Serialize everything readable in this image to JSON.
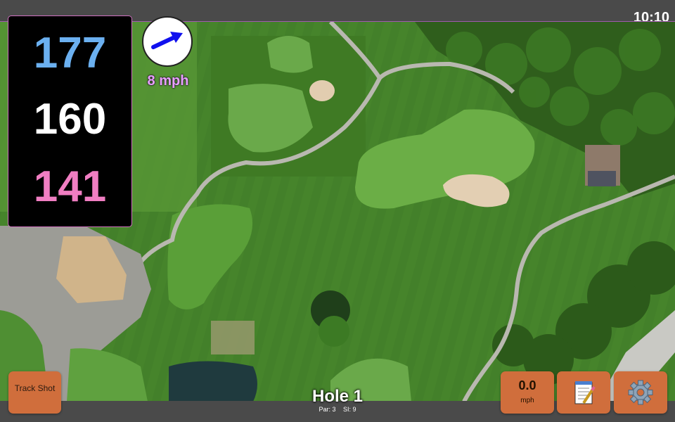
{
  "status": {
    "time": "10:10"
  },
  "yardage": {
    "back": "177",
    "middle": "160",
    "front": "141"
  },
  "wind": {
    "speed": "8 mph",
    "icon": "arrow-icon"
  },
  "hole": {
    "title": "Hole 1",
    "par": "Par: 3",
    "si": "SI: 9"
  },
  "buttons": {
    "track_shot": "Track Shot",
    "speed_value": "0.0",
    "speed_unit": "mph",
    "notes_icon": "notepad-icon",
    "settings_icon": "gear-icon"
  },
  "colors": {
    "back_yardage": "#6bb0f0",
    "middle_yardage": "#ffffff",
    "front_yardage": "#f07ec2",
    "button": "#d06e3c",
    "wind_text": "#e8a0ff"
  }
}
